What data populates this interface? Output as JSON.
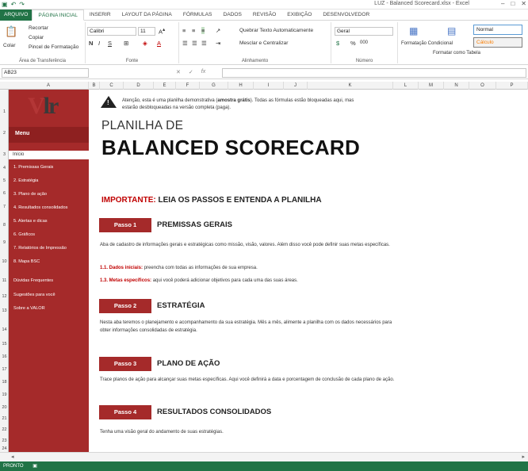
{
  "window": {
    "title": "LUZ - Balanced Scorecard.xlsx - Excel"
  },
  "ribbon_tabs": [
    "ARQUIVO",
    "PÁGINA INICIAL",
    "INSERIR",
    "LAYOUT DA PÁGINA",
    "FÓRMULAS",
    "DADOS",
    "REVISÃO",
    "EXIBIÇÃO",
    "DESENVOLVEDOR"
  ],
  "ribbon": {
    "clipboard": {
      "paste": "Colar",
      "cut": "Recortar",
      "copy": "Copiar",
      "format_painter": "Pincel de Formatação",
      "label": "Área de Transferência"
    },
    "font": {
      "name": "Calibri",
      "size": "11",
      "label": "Fonte",
      "bold": "N",
      "italic": "I",
      "underline": "S"
    },
    "alignment": {
      "wrap": "Quebrar Texto Automaticamente",
      "merge": "Mesclar e Centralizar",
      "label": "Alinhamento"
    },
    "number": {
      "format": "Geral",
      "label": "Número",
      "percent": "%",
      "thousands": "000"
    },
    "styles": {
      "cond": "Formatação Condicional",
      "table": "Formatar como Tabela",
      "normal": "Normal",
      "calc": "Cálculo"
    }
  },
  "formula_bar": {
    "namebox": "AB23",
    "fx": "fx"
  },
  "columns": [
    "A",
    "B",
    "C",
    "D",
    "E",
    "F",
    "G",
    "H",
    "I",
    "J",
    "K",
    "L",
    "M",
    "N",
    "O",
    "P"
  ],
  "rows": [
    "1",
    "2",
    "3",
    "4",
    "5",
    "6",
    "7",
    "8",
    "9",
    "10",
    "11",
    "12",
    "13",
    "14",
    "15",
    "16",
    "17",
    "18",
    "19",
    "20",
    "21",
    "22",
    "23",
    "24"
  ],
  "sidebar": {
    "logo_a": "V",
    "logo_b": "lr",
    "menu": "Menu",
    "inicio": "Início",
    "items": [
      "1. Premissas Gerais",
      "2. Estratégia",
      "3. Plano de ação",
      "4. Resultados consolidados",
      "5. Alertas e dicas",
      "6. Gráficos",
      "7. Relatórios de Impressão",
      "8. Mapa BSC"
    ],
    "extra": [
      "Dúvidas Frequentes",
      "Sugestões para você",
      "Sobre a VALOR"
    ]
  },
  "content": {
    "warning_prefix": "Atenção, esta é uma planilha demonstrativa (",
    "warning_bold": "amostra grátis",
    "warning_suffix": "). Todas as fórmulas estão bloqueadas aqui, mas estarão desbloqueadas na versão completa (paga).",
    "title1": "PLANILHA DE",
    "title2": "BALANCED SCORECARD",
    "imp_red": "IMPORTANTE:",
    "imp_rest": " LEIA OS PASSOS E ENTENDA A PLANILHA",
    "steps": [
      {
        "tag": "Passo 1",
        "title": "PREMISSAS GERAIS",
        "desc": "Aba de cadastro de informações gerais e estratégicas como missão, visão, valores. Além disso você pode definir suas metas específicas."
      },
      {
        "tag": "Passo 2",
        "title": "ESTRATÉGIA",
        "desc": "Nesta aba teremos o planejamento e acompanhamento da sua estratégia. Mês a mês, alimente a planilha com os dados necessários para obter informações consolidadas de estratégia."
      },
      {
        "tag": "Passo 3",
        "title": "PLANO DE AÇÃO",
        "desc": "Trace planos de ação para alcançar suas metas específicas. Aqui você definirá a data e porcentagem de conclusão de cada plano de ação."
      },
      {
        "tag": "Passo 4",
        "title": "RESULTADOS CONSOLIDADOS",
        "desc": "Tenha uma visão geral do andamento de suas estratégias."
      }
    ],
    "sub1_label": "1.1. Dados iniciais:",
    "sub1_text": " preencha com todas as informações de sua empresa.",
    "sub2_label": "1.3. Metas específicos:",
    "sub2_text": " aqui você poderá adicionar objetivos para cada uma das suas áreas."
  },
  "status": {
    "ready": "PRONTO"
  },
  "colors": {
    "excel_green": "#217346",
    "sidebar_red": "#a52a2a",
    "accent_red": "#c00000"
  }
}
